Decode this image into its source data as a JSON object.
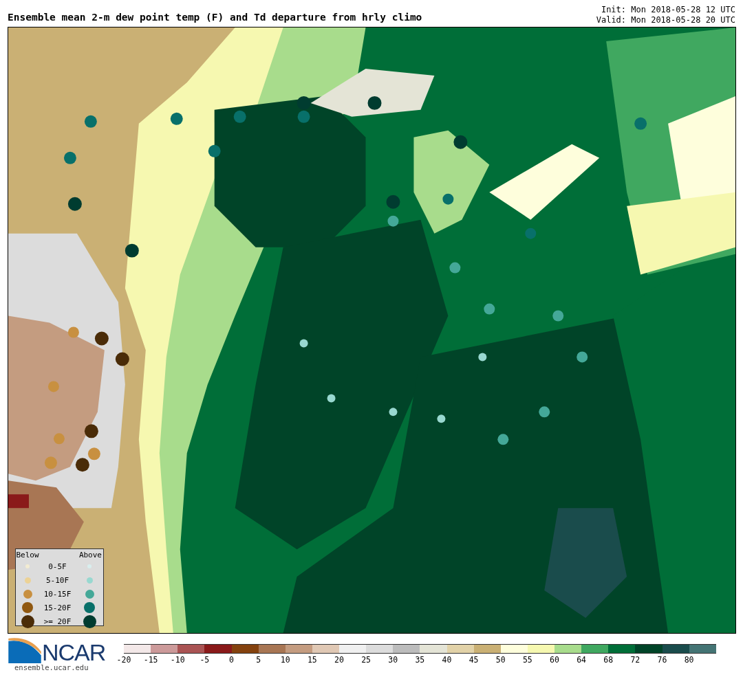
{
  "header": {
    "title": "Ensemble mean 2-m dew point temp (F) and Td departure from hrly climo",
    "init": "Init: Mon 2018-05-28 12 UTC",
    "valid": "Valid: Mon 2018-05-28 20 UTC"
  },
  "legend": {
    "below_heading": "Below",
    "above_heading": "Above",
    "rows": [
      {
        "label": "0-5F",
        "below": {
          "color": "#f3ecd2"
        },
        "above": {
          "color": "#d8eeee"
        }
      },
      {
        "label": "5-10F",
        "below": {
          "color": "#ecd296"
        },
        "above": {
          "color": "#98d8d0"
        }
      },
      {
        "label": "10-15F",
        "below": {
          "color": "#c89040"
        },
        "above": {
          "color": "#44a898"
        }
      },
      {
        "label": "15-20F",
        "below": {
          "color": "#905810"
        },
        "above": {
          "color": "#08706a"
        }
      },
      {
        "label": ">= 20F",
        "below": {
          "color": "#4a2c08"
        },
        "above": {
          "color": "#003c30"
        }
      }
    ]
  },
  "footer": {
    "logo": "NCAR",
    "url": "ensemble.ucar.edu"
  },
  "colorbar": [
    {
      "label": "-20",
      "color": "#f3e8e8"
    },
    {
      "label": "-15",
      "color": "#cc9a9a"
    },
    {
      "label": "-10",
      "color": "#aa5454"
    },
    {
      "label": "-5",
      "color": "#8a1a1a"
    },
    {
      "label": "0",
      "color": "#84420e"
    },
    {
      "label": "5",
      "color": "#a87654"
    },
    {
      "label": "10",
      "color": "#c49c80"
    },
    {
      "label": "15",
      "color": "#e0c8b4"
    },
    {
      "label": "20",
      "color": "#f0f0f0"
    },
    {
      "label": "25",
      "color": "#dcdcdc"
    },
    {
      "label": "30",
      "color": "#bcbcbc"
    },
    {
      "label": "35",
      "color": "#e4e4d6"
    },
    {
      "label": "40",
      "color": "#e2d2a8"
    },
    {
      "label": "45",
      "color": "#cab074"
    },
    {
      "label": "50",
      "color": "#fefedc"
    },
    {
      "label": "55",
      "color": "#f6f8b0"
    },
    {
      "label": "60",
      "color": "#a8dc8c"
    },
    {
      "label": "64",
      "color": "#40a860"
    },
    {
      "label": "68",
      "color": "#006e38"
    },
    {
      "label": "72",
      "color": "#004428"
    },
    {
      "label": "76",
      "color": "#1a4c4c"
    },
    {
      "label": "80",
      "color": "#447474"
    }
  ]
}
